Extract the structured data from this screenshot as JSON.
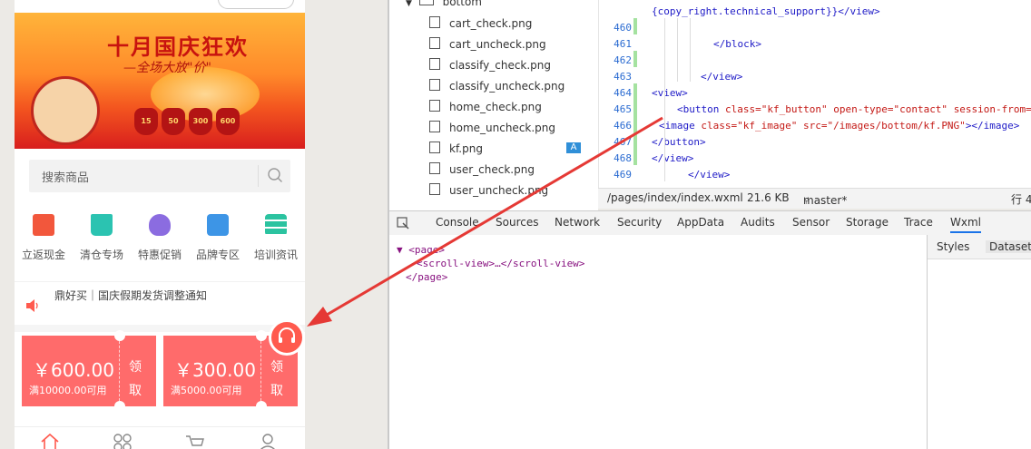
{
  "phone": {
    "banner": {
      "title": "十月国庆狂欢",
      "subtitle": "—全场大放\"价\"",
      "bags": [
        "15",
        "50",
        "300",
        "600"
      ]
    },
    "search": {
      "placeholder": "搜索商品"
    },
    "categories": [
      {
        "label": "立返现金",
        "icon": "cash-back-icon",
        "color": "#f2573c"
      },
      {
        "label": "清仓专场",
        "icon": "shopping-bag-icon",
        "color": "#2bc3b1"
      },
      {
        "label": "特惠促销",
        "icon": "money-bag-icon",
        "color": "#8b6ce0"
      },
      {
        "label": "品牌专区",
        "icon": "box-icon",
        "color": "#3d95e6"
      },
      {
        "label": "培训资讯",
        "icon": "server-icon",
        "color": "#2bc3a0"
      }
    ],
    "notice": {
      "text": "鼎好买｜国庆假期发货调整通知"
    },
    "coupons": [
      {
        "amount": "￥600.00",
        "condition": "满10000.00可用",
        "take": "领取"
      },
      {
        "amount": "￥300.00",
        "condition": "满5000.00可用",
        "take": "领取"
      }
    ],
    "tabbar": [
      "home-icon",
      "category-icon",
      "cart-icon",
      "user-icon"
    ]
  },
  "explorer": {
    "folder": "bottom",
    "files": [
      "cart_check.png",
      "cart_uncheck.png",
      "classify_check.png",
      "classify_uncheck.png",
      "home_check.png",
      "home_uncheck.png",
      "kf.png",
      "user_check.png",
      "user_uncheck.png"
    ],
    "badge": "A"
  },
  "editor": {
    "line_numbers": [
      "460",
      "461",
      "462",
      "463",
      "464",
      "465",
      "466",
      "467",
      "468",
      "469"
    ],
    "top_fragment": "{copy_right.technical_support}}</view>",
    "code": {
      "block_close": "</block>",
      "view_close": "</view>",
      "view_open": "<view>",
      "button_tag": "<button",
      "button_class_attr": "class=",
      "button_class_val": "\"kf_button\"",
      "button_type_attr": "open-type=",
      "button_type_val": "\"contact\"",
      "button_session_attr": "session-from=",
      "button_session_val": "\"",
      "image_tag": "<image",
      "image_class_attr": "class=",
      "image_class_val": "\"kf_image\"",
      "image_src_attr": "src=",
      "image_src_val": "\"/images/bottom/kf.PNG\"",
      "image_close": "></image>",
      "button_close": "</button>",
      "view_close2": "</view>",
      "view_close3": "</view>"
    },
    "status": {
      "path": "/pages/index/index.wxml",
      "size": "21.6 KB",
      "branch": "master*",
      "line": "行 4"
    }
  },
  "devtools": {
    "tabs": [
      "Console",
      "Sources",
      "Network",
      "Security",
      "AppData",
      "Audits",
      "Sensor",
      "Storage",
      "Trace",
      "Wxml"
    ],
    "active_tab": "Wxml",
    "dom": [
      "▼ <page>",
      "<scroll-view>…</scroll-view>",
      "</page>"
    ],
    "side_tabs": [
      "Styles",
      "Dataset"
    ]
  }
}
